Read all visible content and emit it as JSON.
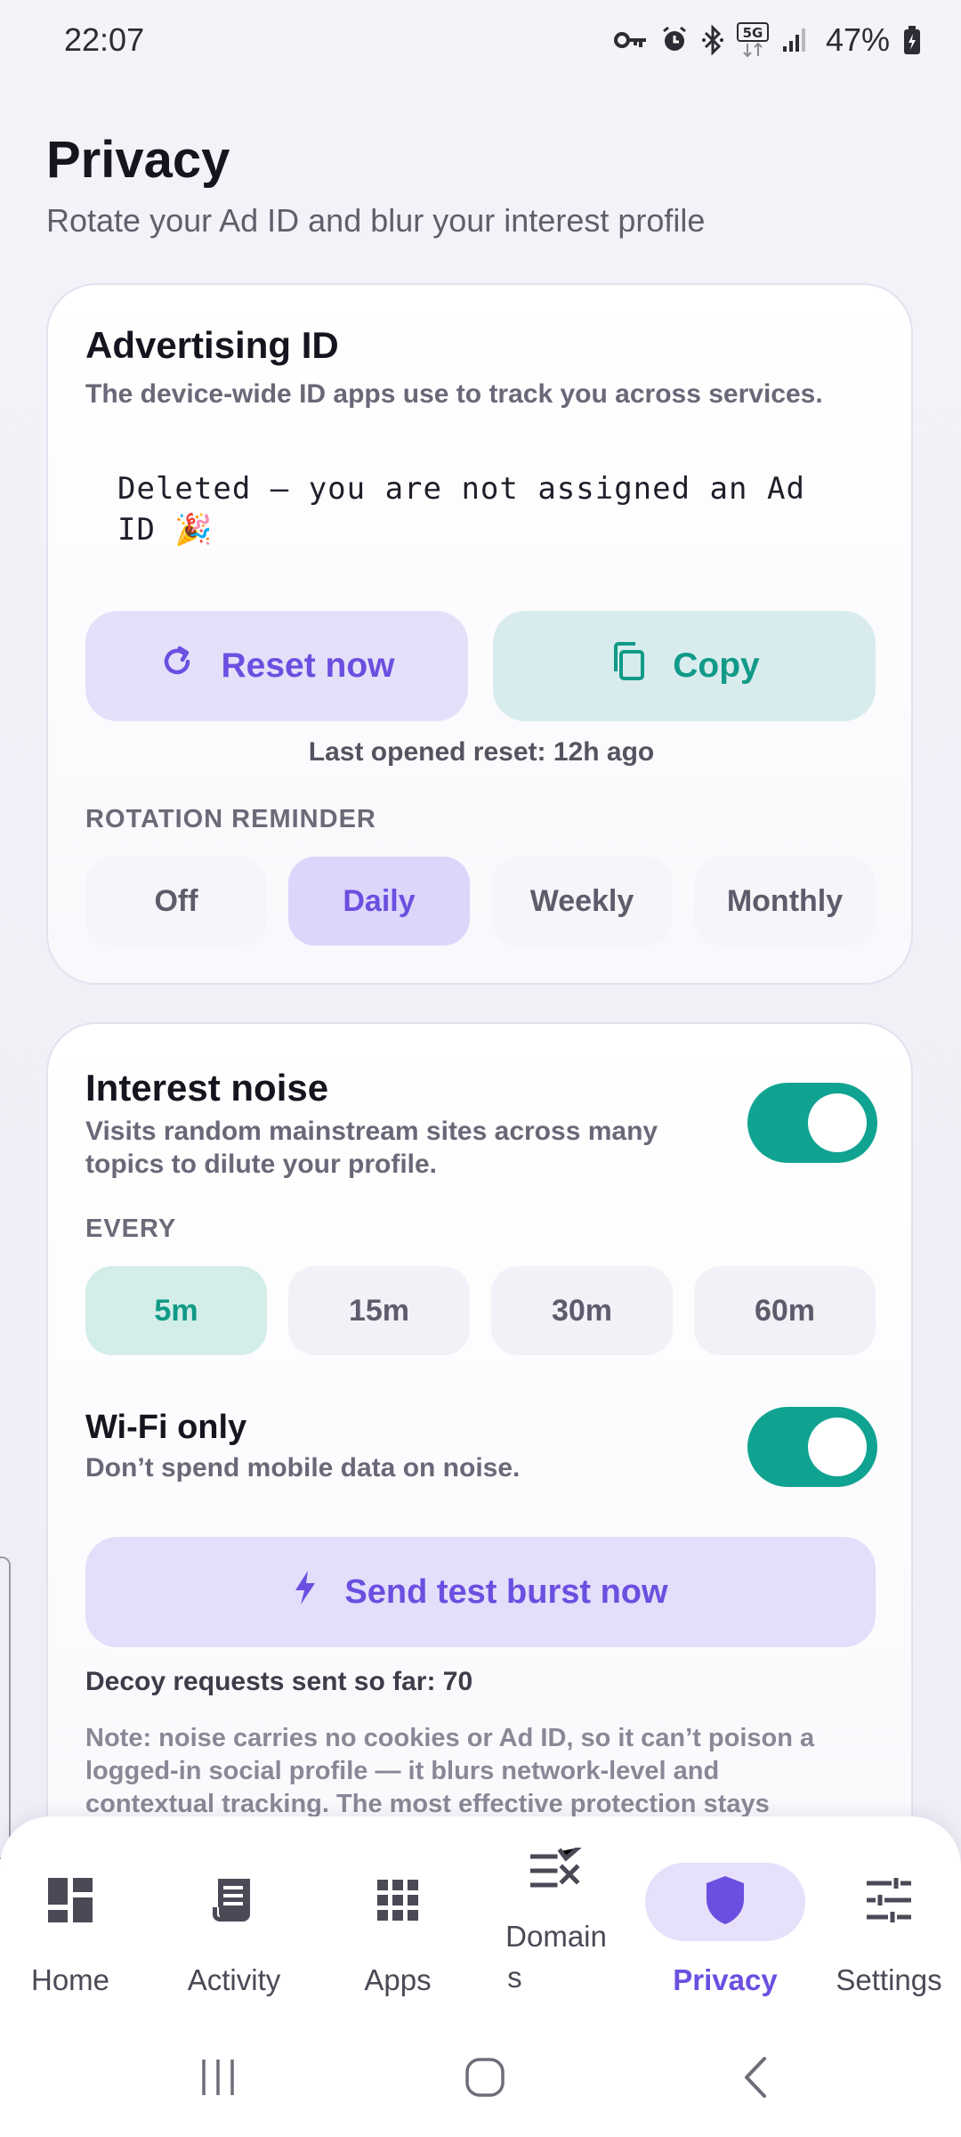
{
  "status_bar": {
    "time": "22:07",
    "battery": "47%",
    "icons": [
      "vpn-key-icon",
      "alarm-icon",
      "bluetooth-icon",
      "5g-icon",
      "signal-icon",
      "battery-charging-icon"
    ]
  },
  "header": {
    "title": "Privacy",
    "subtitle": "Rotate your Ad ID and blur your interest profile"
  },
  "ad_card": {
    "title": "Advertising ID",
    "description": "The device-wide ID apps use to track you across services.",
    "value_line1": "Deleted — you are not assigned an Ad",
    "value_line2": "ID 🎉",
    "reset_label": "Reset now",
    "copy_label": "Copy",
    "last_reset": "Last opened reset: 12h ago",
    "rotation_label": "ROTATION REMINDER",
    "rotation_options": [
      "Off",
      "Daily",
      "Weekly",
      "Monthly"
    ],
    "rotation_selected": "Daily"
  },
  "noise_card": {
    "title": "Interest noise",
    "description_line1": "Visits random mainstream sites across many",
    "description_line2": "topics to dilute your profile.",
    "enabled": true,
    "every_label": "EVERY",
    "interval_options": [
      "5m",
      "15m",
      "30m",
      "60m"
    ],
    "interval_selected": "5m",
    "wifi_title": "Wi-Fi only",
    "wifi_desc": "Don’t spend mobile data on noise.",
    "wifi_enabled": true,
    "burst_label": "Send test burst now",
    "counter_text": "Decoy requests sent so far: 70",
    "note_line1": "Note: noise carries no cookies or Ad ID, so it can’t poison a",
    "note_line2": "logged-in social profile — it blurs network-level and",
    "note_line3": "contextual tracking. The most effective protection stays"
  },
  "bottom_nav": {
    "items": [
      {
        "label": "Home",
        "icon": "dashboard-icon"
      },
      {
        "label": "Activity",
        "icon": "receipt-icon"
      },
      {
        "label": "Apps",
        "icon": "apps-grid-icon"
      },
      {
        "label_line1": "Domain",
        "label_line2": "s",
        "icon": "domain-rules-icon"
      },
      {
        "label": "Privacy",
        "icon": "shield-icon"
      },
      {
        "label": "Settings",
        "icon": "sliders-icon"
      }
    ],
    "active": "Privacy"
  },
  "colors": {
    "accent_purple": "#6b4fe0",
    "accent_teal": "#11a391",
    "background": "#f3f3f8"
  }
}
